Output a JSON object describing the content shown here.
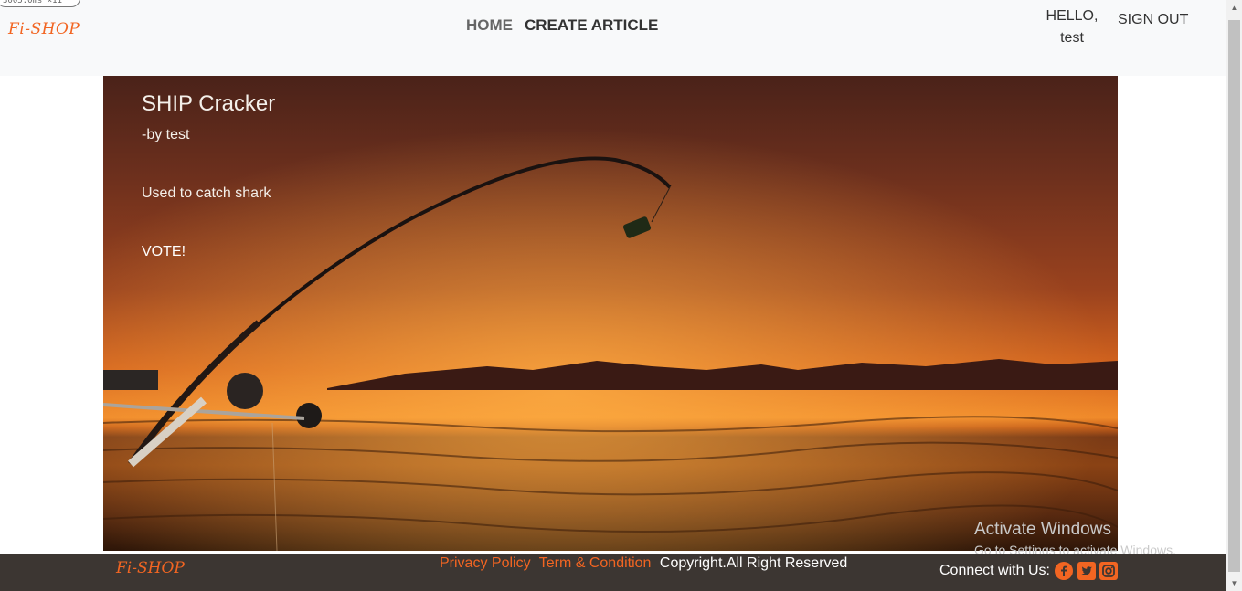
{
  "debug": {
    "fps_text": "3005.0ms ×11"
  },
  "navbar": {
    "brand": "Fi-SHOP",
    "home": "HOME",
    "create": "CREATE ARTICLE",
    "hello": "HELLO,",
    "username": "test",
    "signout": "SIGN OUT"
  },
  "article": {
    "title": "SHIP Cracker",
    "author": "-by test",
    "description": "Used to catch shark",
    "vote": "VOTE!"
  },
  "watermark": {
    "title": "Activate Windows",
    "subtitle": "Go to Settings to activate Windows."
  },
  "footer": {
    "brand": "Fi-SHOP",
    "privacy": "Privacy Policy",
    "terms": "Term & Condition",
    "copyright": "Copyright.All Right Reserved",
    "connect": "Connect with Us:",
    "social": [
      "facebook-icon",
      "twitter-icon",
      "instagram-icon"
    ],
    "accent_color": "#f26522"
  }
}
